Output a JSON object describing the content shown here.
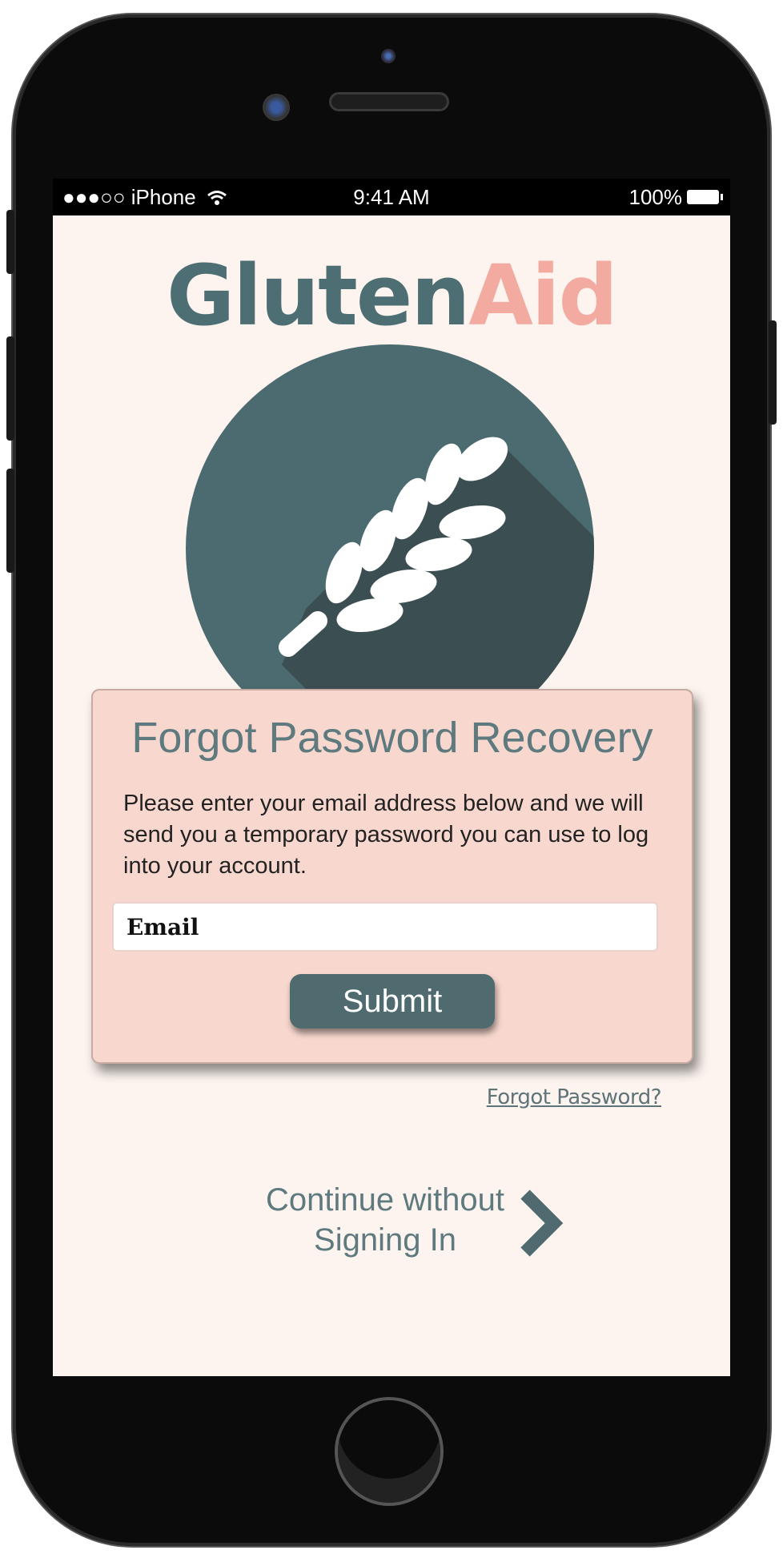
{
  "status_bar": {
    "carrier": "●●●○○ iPhone",
    "wifi_icon": "wifi-icon",
    "time": "9:41 AM",
    "battery": "100%"
  },
  "logo": {
    "part1": "Gluten",
    "part2": "Aid",
    "part1_color": "#4d6e73",
    "part2_color": "#f2aaa1",
    "icon": "wheat-icon"
  },
  "modal": {
    "title": "Forgot Password Recovery",
    "text": "Please enter your email address below and we will send you a temporary password you can use to log into your account.",
    "email_placeholder": "Email",
    "submit_label": "Submit",
    "background": "#f8d8ce",
    "button_color": "#4f6b70"
  },
  "forgot_password": "Forgot Password?",
  "continue": {
    "line1": "Continue without",
    "line2": "Signing In",
    "icon": "chevron-right-icon"
  }
}
